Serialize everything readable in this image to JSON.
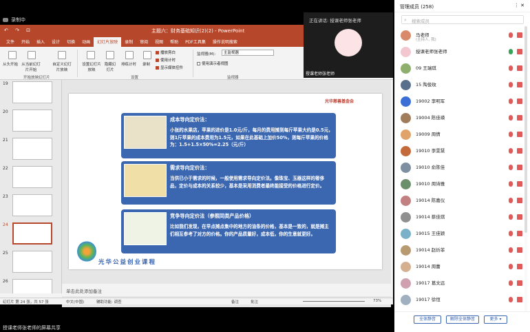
{
  "recording": {
    "label": "录制中"
  },
  "ppt": {
    "quick_access": "↶ ↷ ⊡",
    "title": "主题六：财务基础知识(2)(2) - PowerPoint",
    "tabs": [
      "文件",
      "开始",
      "插入",
      "设计",
      "切换",
      "动画",
      "幻灯片放映",
      "录制",
      "审阅",
      "视图",
      "帮助",
      "PDF工具集",
      "操作说明搜索"
    ],
    "active_tab": "幻灯片放映",
    "ribbon": {
      "from_start": "从头开始",
      "from_current": "从当前幻灯片开始",
      "custom": "自定义幻灯片放映",
      "group_start": "开始放映幻灯片",
      "setup": "设置幻灯片放映",
      "hide": "隐藏幻灯片",
      "rehearse": "排练计时",
      "record": "录制",
      "chk_narration": "播放旁白",
      "chk_timing": "使用计时",
      "chk_controls": "显示媒体控件",
      "group_setup": "设置",
      "monitor_label": "监视器(M):",
      "monitor_value": "主监视器",
      "presenter": "使用演示者视图",
      "group_monitor": "监视器"
    },
    "thumbnails": [
      "19",
      "20",
      "21",
      "22",
      "23",
      "24",
      "25",
      "26"
    ],
    "selected_slide": "24",
    "slide": {
      "logo": "光华慈善基金会",
      "cards": [
        {
          "title": "成本导向定价法：",
          "body": "小张的水果店，苹果的进价是1.0元/斤，每月的费用摊到每斤苹果大约是0.5元，则1斤苹果的成本费用为1.5元，如果在此基础上加价50%，则每斤苹果的价格为：1.5+1.5×50%=2.25（元/斤）"
        },
        {
          "title": "需求导向定价法：",
          "body": "当供已小于需求的时候，一般使用需求导向定价法。像珠宝、玉器这样的奢侈品，定价与成本的关系较少，基本是采用消费者最终能接受的价格进行定价。"
        },
        {
          "title": "竞争导向定价法（参照同类产品价格）",
          "body": "比如我们发现，在早点摊点集中的地方的油条的价格，基本是一致的，就是摊主们相互参考了对方的价格。你的产品质量好，成本低，你的生意就更好。"
        }
      ],
      "bottom_logo": "光华公益创业课程"
    },
    "notes_placeholder": "单击此处添加备注",
    "status": {
      "slide_count": "幻灯片 第 24 张，共 57 张",
      "language": "中文(中国)",
      "accessibility": "辅助功能: 调查",
      "notes_btn": "备注",
      "comments_btn": "批注",
      "zoom": "73%"
    }
  },
  "video": {
    "speaking": "正在讲话: 授课老师张老师",
    "speaker_name": "授课老师张老师"
  },
  "members": {
    "header": "管理成员 (258)",
    "search_placeholder": "搜索成员",
    "list": [
      {
        "name": "马老师",
        "sub": "(主持人, 我)",
        "avatar_color": "#d98a6a"
      },
      {
        "name": "授课老师张老师",
        "sub": "",
        "avatar_color": "#f2c7cf"
      },
      {
        "name": "09 王瑞琪",
        "sub": "",
        "avatar_color": "#8fb06d"
      },
      {
        "name": "15 陶俊玫",
        "sub": "",
        "avatar_color": "#5a6f8c"
      },
      {
        "name": "19002 李明军",
        "sub": "",
        "avatar_color": "#3b6fd6"
      },
      {
        "name": "19004 陈佳瑛",
        "sub": "",
        "avatar_color": "#a07c5a"
      },
      {
        "name": "19009 周倩",
        "sub": "",
        "avatar_color": "#e0a36a"
      },
      {
        "name": "19010 李雯慧",
        "sub": "",
        "avatar_color": "#c46a3a"
      },
      {
        "name": "19010 俞陈佳",
        "sub": "",
        "avatar_color": "#7d8fa0"
      },
      {
        "name": "19010 周诗雅",
        "sub": "",
        "avatar_color": "#6b8f6b"
      },
      {
        "name": "19014 陈嘉仪",
        "sub": "",
        "avatar_color": "#c28080"
      },
      {
        "name": "19014 蔡佳琪",
        "sub": "",
        "avatar_color": "#909090"
      },
      {
        "name": "19015 王佳颖",
        "sub": "",
        "avatar_color": "#7ab0c8"
      },
      {
        "name": "19014 赵炘菲",
        "sub": "",
        "avatar_color": "#b89a70"
      },
      {
        "name": "19014 周蕾",
        "sub": "",
        "avatar_color": "#d4b090"
      },
      {
        "name": "19017 葛文远",
        "sub": "",
        "avatar_color": "#cfa0b0"
      },
      {
        "name": "19017 徐恒",
        "sub": "",
        "avatar_color": "#a0b0c0"
      }
    ],
    "btn_mute_all": "全体静音",
    "btn_unmute_all": "解除全体静音",
    "btn_more": "更多 ▾"
  },
  "bottom_bar": {
    "text": "授课老师张老师的屏幕共享"
  },
  "colors": {
    "ppt_red": "#b7472a",
    "card_blue": "#3b66b0",
    "mute_red": "#e05a5a",
    "mic_green": "#3aa35a"
  }
}
